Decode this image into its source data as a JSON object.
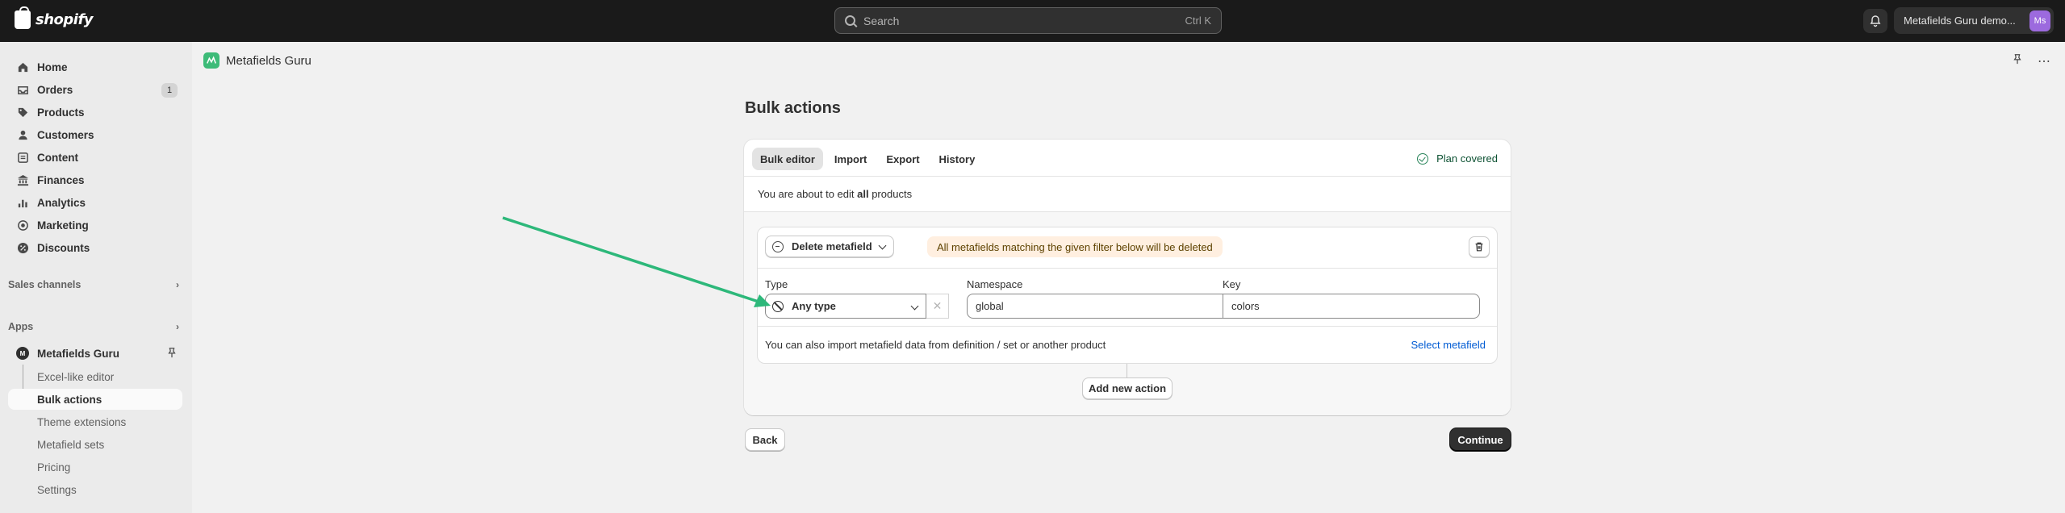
{
  "topbar": {
    "logo_text": "shopify",
    "search_placeholder": "Search",
    "search_shortcut": "Ctrl K",
    "store_name": "Metafields Guru demo...",
    "avatar_initials": "Ms"
  },
  "sidebar": {
    "items": [
      {
        "label": "Home",
        "icon": "home-icon"
      },
      {
        "label": "Orders",
        "icon": "inbox-icon",
        "badge": "1"
      },
      {
        "label": "Products",
        "icon": "tag-icon"
      },
      {
        "label": "Customers",
        "icon": "person-icon"
      },
      {
        "label": "Content",
        "icon": "content-icon"
      },
      {
        "label": "Finances",
        "icon": "bank-icon"
      },
      {
        "label": "Analytics",
        "icon": "bar-chart-icon"
      },
      {
        "label": "Marketing",
        "icon": "target-icon"
      },
      {
        "label": "Discounts",
        "icon": "discount-icon"
      }
    ],
    "sales_channels_label": "Sales channels",
    "apps_label": "Apps",
    "app_name": "Metafields Guru",
    "app_sub_items": [
      "Excel-like editor",
      "Bulk actions",
      "Theme extensions",
      "Metafield sets",
      "Pricing",
      "Settings"
    ],
    "active_sub_item": "Bulk actions"
  },
  "app_header": {
    "title": "Metafields Guru"
  },
  "page": {
    "title": "Bulk actions",
    "tabs": [
      "Bulk editor",
      "Import",
      "Export",
      "History"
    ],
    "active_tab": "Bulk editor",
    "plan_status": "Plan covered",
    "edit_note_prefix": "You are about to edit ",
    "edit_note_bold": "all",
    "edit_note_suffix": " products",
    "action": {
      "selected_action": "Delete metafield",
      "warning": "All metafields matching the given filter below will be deleted",
      "type_label": "Type",
      "type_value": "Any type",
      "namespace_label": "Namespace",
      "namespace_value": "global",
      "key_label": "Key",
      "key_value": "colors",
      "import_note": "You can also import metafield data from definition / set or another product",
      "select_link": "Select metafield"
    },
    "add_action_label": "Add new action",
    "back_label": "Back",
    "continue_label": "Continue"
  },
  "colors": {
    "topbar_bg": "#1a1a1a",
    "accent_green": "#29845a",
    "link_blue": "#005bd3",
    "warning_bg": "#ffefe0",
    "annotation_arrow": "#2db87a"
  }
}
